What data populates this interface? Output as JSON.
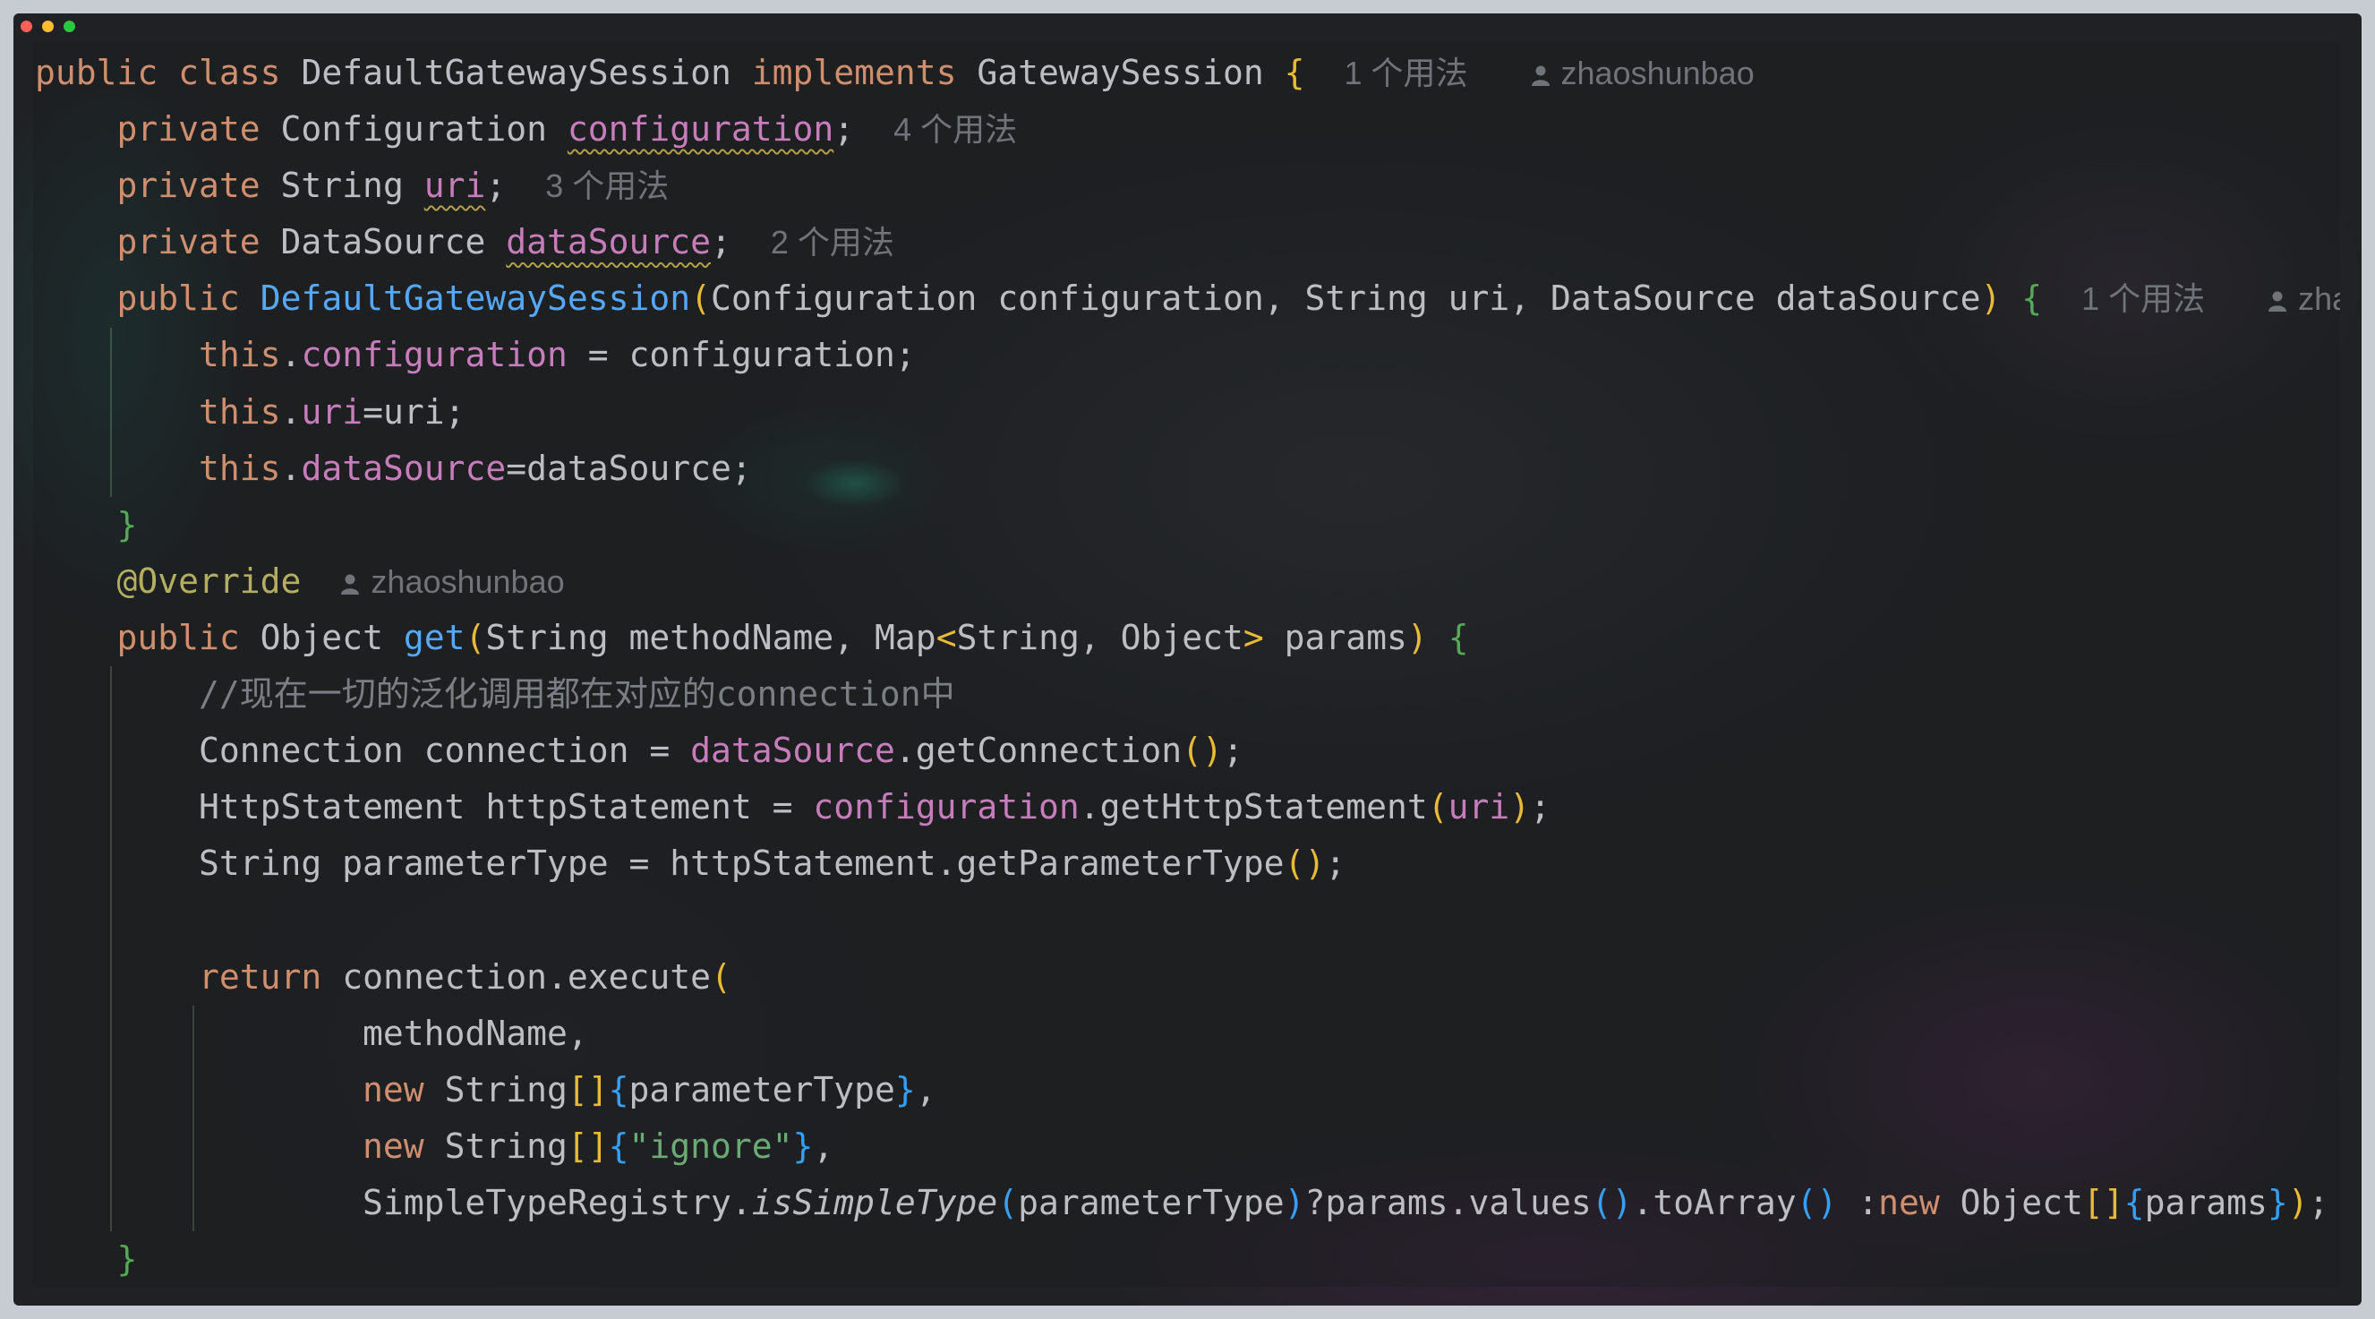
{
  "theme": {
    "frame": "#c7ccd3",
    "editor_bg": "#1f2124",
    "syntax": {
      "plain": "#bcbec4",
      "keyword": "#cf8e6d",
      "field": "#c77dbb",
      "method-decl": "#56a8f5",
      "annotation": "#b3ae60",
      "string": "#6aab73",
      "comment": "#7a7e85",
      "static-call": "#bcbec4",
      "br1": "#e8ba36",
      "br2": "#54a857",
      "br3": "#359ff4",
      "hint": "#6f737a",
      "squiggle": "#b5a04a"
    }
  },
  "window": {
    "controls": [
      {
        "name": "close",
        "color": "#ff5f57"
      },
      {
        "name": "minimize",
        "color": "#febc2e"
      },
      {
        "name": "maximize",
        "color": "#28c840"
      }
    ]
  },
  "editor": {
    "lines": [
      {
        "tokens": [
          [
            "public",
            "keyword"
          ],
          [
            " ",
            "plain"
          ],
          [
            "class",
            "keyword"
          ],
          [
            " DefaultGatewaySession ",
            "plain"
          ],
          [
            "implements",
            "keyword"
          ],
          [
            " GatewaySession ",
            "plain"
          ],
          [
            "{",
            "br1"
          ]
        ],
        "hints": [
          {
            "type": "usages",
            "text": "1 个用法"
          },
          {
            "type": "author",
            "icon": "person-icon",
            "text": "zhaoshunbao"
          }
        ]
      },
      {
        "tokens": [
          [
            "    ",
            "plain"
          ],
          [
            "private",
            "keyword"
          ],
          [
            " Configuration ",
            "plain"
          ],
          [
            "configuration",
            "field-decl"
          ],
          [
            ";",
            "plain"
          ]
        ],
        "hints": [
          {
            "type": "usages",
            "text": "4 个用法"
          }
        ]
      },
      {
        "tokens": [
          [
            "    ",
            "plain"
          ],
          [
            "private",
            "keyword"
          ],
          [
            " String ",
            "plain"
          ],
          [
            "uri",
            "field-decl"
          ],
          [
            ";",
            "plain"
          ]
        ],
        "hints": [
          {
            "type": "usages",
            "text": "3 个用法"
          }
        ]
      },
      {
        "tokens": [
          [
            "    ",
            "plain"
          ],
          [
            "private",
            "keyword"
          ],
          [
            " DataSource ",
            "plain"
          ],
          [
            "dataSource",
            "field-decl"
          ],
          [
            ";",
            "plain"
          ]
        ],
        "hints": [
          {
            "type": "usages",
            "text": "2 个用法"
          }
        ]
      },
      {
        "tokens": [
          [
            "    ",
            "plain"
          ],
          [
            "public",
            "keyword"
          ],
          [
            " ",
            "plain"
          ],
          [
            "DefaultGatewaySession",
            "method-decl"
          ],
          [
            "(",
            "br1"
          ],
          [
            "Configuration configuration, String uri, DataSource dataSource",
            "plain"
          ],
          [
            ")",
            "br1"
          ],
          [
            " ",
            "plain"
          ],
          [
            "{",
            "br2"
          ]
        ],
        "hints": [
          {
            "type": "usages",
            "text": "1 个用法"
          },
          {
            "type": "author",
            "icon": "person-icon",
            "text": "zhaoshunbao"
          }
        ]
      },
      {
        "tokens": [
          [
            "        ",
            "plain"
          ],
          [
            "this",
            "keyword"
          ],
          [
            ".",
            "plain"
          ],
          [
            "configuration",
            "field"
          ],
          [
            " = configuration;",
            "plain"
          ]
        ]
      },
      {
        "tokens": [
          [
            "        ",
            "plain"
          ],
          [
            "this",
            "keyword"
          ],
          [
            ".",
            "plain"
          ],
          [
            "uri",
            "field"
          ],
          [
            "=uri;",
            "plain"
          ]
        ]
      },
      {
        "tokens": [
          [
            "        ",
            "plain"
          ],
          [
            "this",
            "keyword"
          ],
          [
            ".",
            "plain"
          ],
          [
            "dataSource",
            "field"
          ],
          [
            "=dataSource;",
            "plain"
          ]
        ]
      },
      {
        "tokens": [
          [
            "    ",
            "plain"
          ],
          [
            "}",
            "br2"
          ]
        ]
      },
      {
        "tokens": [
          [
            "    ",
            "plain"
          ],
          [
            "@Override",
            "annotation"
          ]
        ],
        "hints": [
          {
            "type": "author",
            "icon": "person-icon",
            "text": "zhaoshunbao"
          }
        ]
      },
      {
        "tokens": [
          [
            "    ",
            "plain"
          ],
          [
            "public",
            "keyword"
          ],
          [
            " Object ",
            "plain"
          ],
          [
            "get",
            "method-decl"
          ],
          [
            "(",
            "br1"
          ],
          [
            "String methodName, Map",
            "plain"
          ],
          [
            "<",
            "br1"
          ],
          [
            "String, Object",
            "plain"
          ],
          [
            ">",
            "br1"
          ],
          [
            " params",
            "plain"
          ],
          [
            ")",
            "br1"
          ],
          [
            " ",
            "plain"
          ],
          [
            "{",
            "br2"
          ]
        ]
      },
      {
        "tokens": [
          [
            "        ",
            "plain"
          ],
          [
            "//现在一切的泛化调用都在对应的connection中",
            "comment"
          ]
        ]
      },
      {
        "tokens": [
          [
            "        Connection connection = ",
            "plain"
          ],
          [
            "dataSource",
            "field"
          ],
          [
            ".getConnection",
            "plain"
          ],
          [
            "()",
            "br1"
          ],
          [
            ";",
            "plain"
          ]
        ]
      },
      {
        "tokens": [
          [
            "        HttpStatement httpStatement = ",
            "plain"
          ],
          [
            "configuration",
            "field"
          ],
          [
            ".getHttpStatement",
            "plain"
          ],
          [
            "(",
            "br1"
          ],
          [
            "uri",
            "field"
          ],
          [
            ")",
            "br1"
          ],
          [
            ";",
            "plain"
          ]
        ]
      },
      {
        "tokens": [
          [
            "        String parameterType = httpStatement.getParameterType",
            "plain"
          ],
          [
            "()",
            "br1"
          ],
          [
            ";",
            "plain"
          ]
        ]
      },
      {
        "tokens": []
      },
      {
        "tokens": [
          [
            "        ",
            "plain"
          ],
          [
            "return",
            "keyword"
          ],
          [
            " connection.execute",
            "plain"
          ],
          [
            "(",
            "br1"
          ]
        ]
      },
      {
        "tokens": [
          [
            "                methodName,",
            "plain"
          ]
        ]
      },
      {
        "tokens": [
          [
            "                ",
            "plain"
          ],
          [
            "new",
            "keyword"
          ],
          [
            " String",
            "plain"
          ],
          [
            "[]",
            "br1"
          ],
          [
            "{",
            "br3"
          ],
          [
            "parameterType",
            "plain"
          ],
          [
            "}",
            "br3"
          ],
          [
            ",",
            "plain"
          ]
        ]
      },
      {
        "tokens": [
          [
            "                ",
            "plain"
          ],
          [
            "new",
            "keyword"
          ],
          [
            " String",
            "plain"
          ],
          [
            "[]",
            "br1"
          ],
          [
            "{",
            "br3"
          ],
          [
            "\"ignore\"",
            "string"
          ],
          [
            "}",
            "br3"
          ],
          [
            ",",
            "plain"
          ]
        ]
      },
      {
        "tokens": [
          [
            "                SimpleTypeRegistry.",
            "plain"
          ],
          [
            "isSimpleType",
            "static-call"
          ],
          [
            "(",
            "br3"
          ],
          [
            "parameterType",
            "plain"
          ],
          [
            ")",
            "br3"
          ],
          [
            "?params.values",
            "plain"
          ],
          [
            "()",
            "br3"
          ],
          [
            ".toArray",
            "plain"
          ],
          [
            "()",
            "br3"
          ],
          [
            " :",
            "plain"
          ],
          [
            "new",
            "keyword"
          ],
          [
            " Object",
            "plain"
          ],
          [
            "[]",
            "br1"
          ],
          [
            "{",
            "br3"
          ],
          [
            "params",
            "plain"
          ],
          [
            "}",
            "br3"
          ],
          [
            ")",
            "br1"
          ],
          [
            ";",
            "plain"
          ]
        ]
      },
      {
        "tokens": [
          [
            "    ",
            "plain"
          ],
          [
            "}",
            "br2"
          ]
        ]
      }
    ]
  }
}
